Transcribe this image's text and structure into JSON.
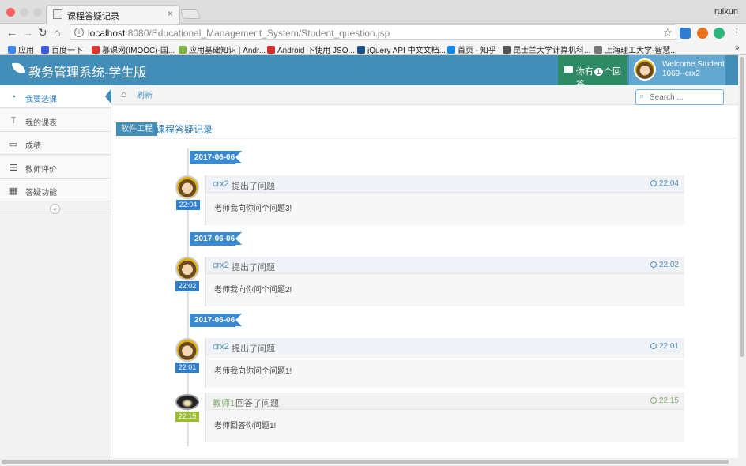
{
  "browser": {
    "tab_title": "课程答疑记录",
    "tab_close": "×",
    "profile": "ruixun",
    "url_host": "localhost",
    "url_rest": ":8080/Educational_Management_System/Student_question.jsp",
    "back": "←",
    "forward": "→",
    "reload": "↻",
    "home": "⌂",
    "star": "☆",
    "menu": "⋮",
    "bookmarks": [
      {
        "label": "应用",
        "color": "#4285f4"
      },
      {
        "label": "百度一下",
        "color": "#3d59e0"
      },
      {
        "label": "慕课网(IMOOC)-国...",
        "color": "#e0332a"
      },
      {
        "label": "应用基础知识 | Andr...",
        "color": "#7cb342"
      },
      {
        "label": "Android 下使用 JSO...",
        "color": "#d32f2f"
      },
      {
        "label": "jQuery API 中文文档...",
        "color": "#1a4f86"
      },
      {
        "label": "首页 - 知乎",
        "color": "#0f88eb"
      },
      {
        "label": "昆士兰大学计算机科...",
        "color": "#555555"
      },
      {
        "label": "上海理工大学-智慧...",
        "color": "#777777"
      }
    ],
    "bookmarks_more": "»"
  },
  "header": {
    "brand": "教务管理系统-学生版",
    "notif_prefix": "你有",
    "notif_count": "1",
    "notif_suffix": "个回答",
    "welcome_line1": "Welcome,Student",
    "welcome_line2": "1069--crx2",
    "accent": "#438eb9"
  },
  "sidebar": {
    "items": [
      {
        "label": "我要选课",
        "icon": "dashboard-icon",
        "glyph": "◔"
      },
      {
        "label": "我的课表",
        "icon": "text-icon",
        "glyph": "T"
      },
      {
        "label": "成绩",
        "icon": "desktop-icon",
        "glyph": "▭"
      },
      {
        "label": "教师评价",
        "icon": "list-icon",
        "glyph": "☰"
      },
      {
        "label": "答疑功能",
        "icon": "calendar-icon",
        "glyph": "▦"
      }
    ],
    "collapse": "«"
  },
  "breadcrumb": {
    "home_glyph": "⌂",
    "refresh": "刷新"
  },
  "search": {
    "placeholder": "Search ...",
    "glyph": "⌕"
  },
  "page": {
    "course_badge": "软件工程",
    "title": "课程答疑记录"
  },
  "timeline": {
    "groups": [
      {
        "date": "2017-06-06"
      },
      {
        "date": "2017-06-06"
      },
      {
        "date": "2017-06-06"
      }
    ],
    "entries": [
      {
        "user": "crx2",
        "action": "提出了问题",
        "time": "22:04",
        "body": "老师我向你问个问题3!"
      },
      {
        "user": "crx2",
        "action": "提出了问题",
        "time": "22:02",
        "body": "老师我向你问个问题2!"
      },
      {
        "user": "crx2",
        "action": "提出了问题",
        "time": "22:01",
        "body": "老师我向你问个问题1!"
      },
      {
        "user": "教师1",
        "action": "回答了问题",
        "time": "22:15",
        "body": "老师回答你问题1!"
      }
    ]
  }
}
